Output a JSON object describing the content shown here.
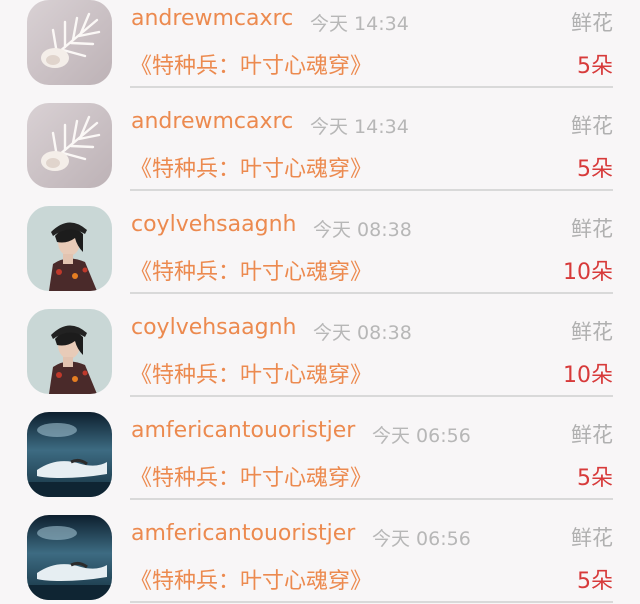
{
  "records": [
    {
      "username": "andrewmcaxrc",
      "time": "今天 14:34",
      "gift_type": "鲜花",
      "book_title": "《特种兵：叶寸心魂穿》",
      "count": "5朵",
      "avatar": "shell-avatar"
    },
    {
      "username": "andrewmcaxrc",
      "time": "今天 14:34",
      "gift_type": "鲜花",
      "book_title": "《特种兵：叶寸心魂穿》",
      "count": "5朵",
      "avatar": "shell-avatar"
    },
    {
      "username": "coylvehsaagnh",
      "time": "今天 08:38",
      "gift_type": "鲜花",
      "book_title": "《特种兵：叶寸心魂穿》",
      "count": "10朵",
      "avatar": "woman-avatar"
    },
    {
      "username": "coylvehsaagnh",
      "time": "今天 08:38",
      "gift_type": "鲜花",
      "book_title": "《特种兵：叶寸心魂穿》",
      "count": "10朵",
      "avatar": "woman-avatar"
    },
    {
      "username": "amfericantouoristjer",
      "time": "今天 06:56",
      "gift_type": "鲜花",
      "book_title": "《特种兵：叶寸心魂穿》",
      "count": "5朵",
      "avatar": "water-scene-avatar"
    },
    {
      "username": "amfericantouoristjer",
      "time": "今天 06:56",
      "gift_type": "鲜花",
      "book_title": "《特种兵：叶寸心魂穿》",
      "count": "5朵",
      "avatar": "water-scene-avatar"
    }
  ],
  "colors": {
    "background": "#f8f6f7",
    "username": "#ec8a4f",
    "book_title": "#ec8a4f",
    "time": "#b7b7b7",
    "gift_type": "#b0b0b0",
    "count": "#d73a3a",
    "divider": "#d9d9d9"
  }
}
